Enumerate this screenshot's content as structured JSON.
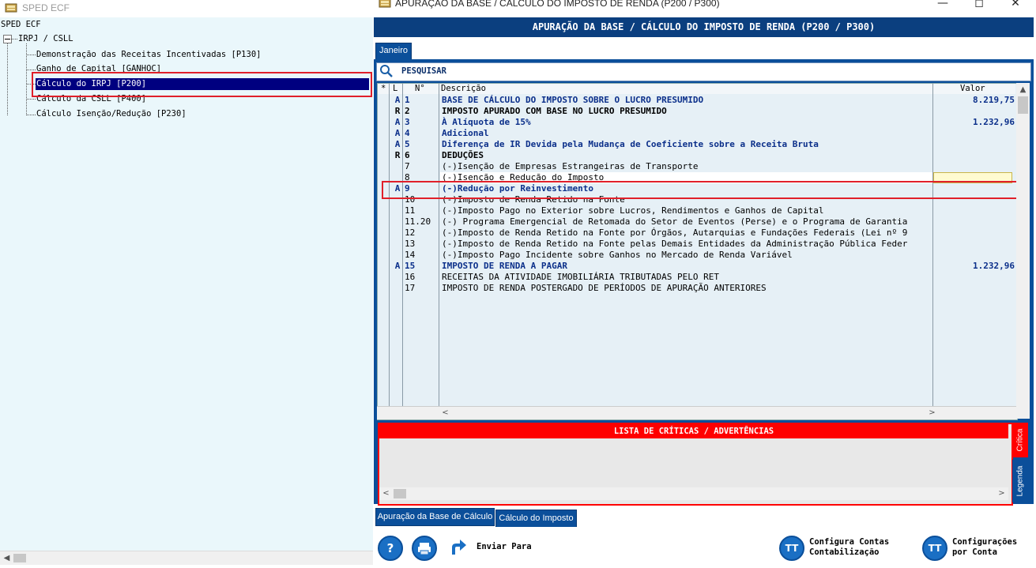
{
  "left_window": {
    "title": "SPED ECF",
    "tree": {
      "root": "SPED ECF",
      "group": "IRPJ / CSLL",
      "items": [
        {
          "label": "Demonstração das Receitas Incentivadas [P130]"
        },
        {
          "label": "Ganho de Capital [GANHOC]"
        },
        {
          "label": "Cálculo do IRPJ [P200]",
          "selected": true
        },
        {
          "label": "Cálculo da CSLL [P400]"
        },
        {
          "label": "Cálculo Isenção/Redução [P230]"
        }
      ]
    }
  },
  "right_window": {
    "title": "APURAÇÃO DA BASE / CÁLCULO DO IMPOSTO DE RENDA (P200 / P300)",
    "header": "APURAÇÃO DA BASE / CÁLCULO DO IMPOSTO DE RENDA (P200 / P300)",
    "month_tab": "Janeiro",
    "search_label": "PESQUISAR",
    "grid": {
      "columns": {
        "star": "*",
        "l": "L",
        "n": "N°",
        "desc": "Descrição",
        "valor": "Valor"
      },
      "rows": [
        {
          "flag": "A",
          "num": "1",
          "desc": "BASE DE CÁLCULO DO IMPOSTO SOBRE O LUCRO PRESUMIDO",
          "valor": "8.219,75",
          "style": "A"
        },
        {
          "flag": "R",
          "num": "2",
          "desc": "IMPOSTO APURADO COM BASE NO LUCRO PRESUMIDO",
          "valor": "",
          "style": "R"
        },
        {
          "flag": "A",
          "num": "3",
          "desc": "À Alíquota de 15%",
          "valor": "1.232,96",
          "style": "A"
        },
        {
          "flag": "A",
          "num": "4",
          "desc": "Adicional",
          "valor": "",
          "style": "A"
        },
        {
          "flag": "A",
          "num": "5",
          "desc": "Diferença de IR Devida pela Mudança de Coeficiente sobre a Receita Bruta",
          "valor": "",
          "style": "A"
        },
        {
          "flag": "R",
          "num": "6",
          "desc": "DEDUÇÕES",
          "valor": "",
          "style": "R"
        },
        {
          "flag": "",
          "num": "7",
          "desc": "(-)Isenção de Empresas Estrangeiras de Transporte",
          "valor": "",
          "style": "E"
        },
        {
          "flag": "",
          "num": "8",
          "desc": "(-)Isenção e Redução do Imposto",
          "valor": "",
          "style": "E"
        },
        {
          "flag": "A",
          "num": "9",
          "desc": "(-)Redução por Reinvestimento",
          "valor": "",
          "style": "A"
        },
        {
          "flag": "",
          "num": "10",
          "desc": "(-)Imposto de Renda Retido na Fonte",
          "valor": "",
          "style": "E"
        },
        {
          "flag": "",
          "num": "11",
          "desc": "(-)Imposto Pago no Exterior sobre Lucros, Rendimentos e Ganhos de Capital",
          "valor": "",
          "style": "E"
        },
        {
          "flag": "",
          "num": "11.20",
          "desc": "(-) Programa Emergencial de Retomada do Setor de Eventos (Perse) e o Programa de Garantia",
          "valor": "",
          "style": "E"
        },
        {
          "flag": "",
          "num": "12",
          "desc": "(-)Imposto de Renda Retido na Fonte por Órgãos, Autarquias e Fundações Federais (Lei nº 9",
          "valor": "",
          "style": "E"
        },
        {
          "flag": "",
          "num": "13",
          "desc": "(-)Imposto de Renda Retido na Fonte pelas Demais Entidades da Administração Pública Feder",
          "valor": "",
          "style": "E"
        },
        {
          "flag": "",
          "num": "14",
          "desc": "(-)Imposto Pago Incidente sobre Ganhos no Mercado de Renda Variável",
          "valor": "",
          "style": "E"
        },
        {
          "flag": "A",
          "num": "15",
          "desc": "IMPOSTO DE RENDA A PAGAR",
          "valor": "1.232,96",
          "style": "A"
        },
        {
          "flag": "",
          "num": "16",
          "desc": "RECEITAS DA ATIVIDADE IMOBILIÁRIA TRIBUTADAS PELO RET",
          "valor": "",
          "style": "E"
        },
        {
          "flag": "",
          "num": "17",
          "desc": "IMPOSTO DE RENDA POSTERGADO DE PERÍODOS DE APURAÇÃO ANTERIORES",
          "valor": "",
          "style": "E"
        }
      ]
    },
    "criticas_header": "LISTA DE CRÍTICAS / ADVERTÊNCIAS",
    "side_tabs": {
      "critica": "Crítica",
      "legenda": "Legenda"
    },
    "bottom_tabs": [
      "Apuração da Base de Cálculo",
      "Cálculo do Imposto"
    ],
    "toolbar": {
      "help_glyph": "?",
      "enviar_para": "Enviar Para",
      "configura_contas_1": "Configura Contas",
      "configura_contas_2": "Contabilização",
      "configuracoes_1": "Configurações",
      "configuracoes_2": "por Conta"
    }
  },
  "colors": {
    "header_blue": "#0b3f7f",
    "tab_blue": "#0b4f9a",
    "grid_bg": "#e6f0f6",
    "selected_bg": "#000080",
    "critica_red": "#ff0000",
    "highlight_red": "#e0202a"
  }
}
